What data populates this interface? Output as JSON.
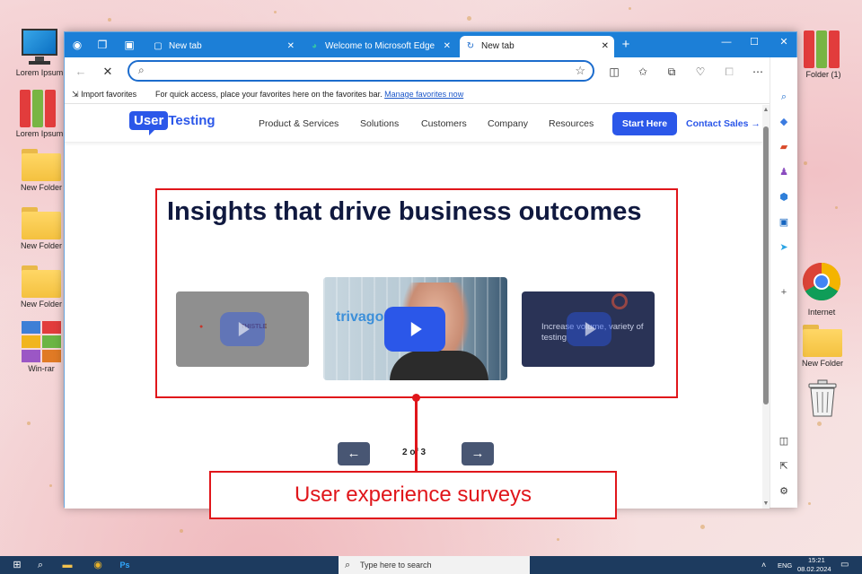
{
  "desktop": {
    "icons_left": [
      {
        "label": "Lorem Ipsum",
        "kind": "computer"
      },
      {
        "label": "Lorem Ipsum",
        "kind": "binders"
      },
      {
        "label": "New Folder",
        "kind": "folder"
      },
      {
        "label": "New Folder",
        "kind": "folder"
      },
      {
        "label": "New Folder",
        "kind": "folder"
      },
      {
        "label": "Win-rar",
        "kind": "winrar"
      }
    ],
    "icons_right": [
      {
        "label": "Folder (1)",
        "kind": "binders"
      },
      {
        "label": "Internet",
        "kind": "chrome"
      },
      {
        "label": "New Folder",
        "kind": "folder"
      },
      {
        "label": "",
        "kind": "recycle-bin"
      }
    ]
  },
  "browser": {
    "tabs": [
      {
        "label": "New tab",
        "active": false
      },
      {
        "label": "Welcome to Microsoft Edge",
        "active": false
      },
      {
        "label": "New tab",
        "active": true
      }
    ],
    "url_value": "",
    "favorites_bar": {
      "import_label": "Import favorites",
      "hint": "For quick access, place your favorites here on the favorites bar.",
      "manage_link": "Manage favorites now"
    }
  },
  "site": {
    "logo_user": "User",
    "logo_testing": "Testing",
    "nav": [
      "Product & Services",
      "Solutions",
      "Customers",
      "Company",
      "Resources"
    ],
    "cta_start": "Start Here",
    "cta_contact": "Contact Sales",
    "headline": "Insights that drive business outcomes",
    "carousel": {
      "slides": [
        {
          "logo_text": "THISTLE",
          "state": "previous"
        },
        {
          "logo_text": "trivago",
          "state": "current"
        },
        {
          "overlay_text": "Increase volume, variety of testing",
          "state": "next"
        }
      ],
      "pager": "2 of 3"
    }
  },
  "annotation": {
    "callout": "User experience surveys",
    "color": "#e0161b"
  },
  "taskbar": {
    "search_placeholder": "Type here to search",
    "lang": "ENG",
    "time": "15:21",
    "date": "08.02.2024"
  }
}
